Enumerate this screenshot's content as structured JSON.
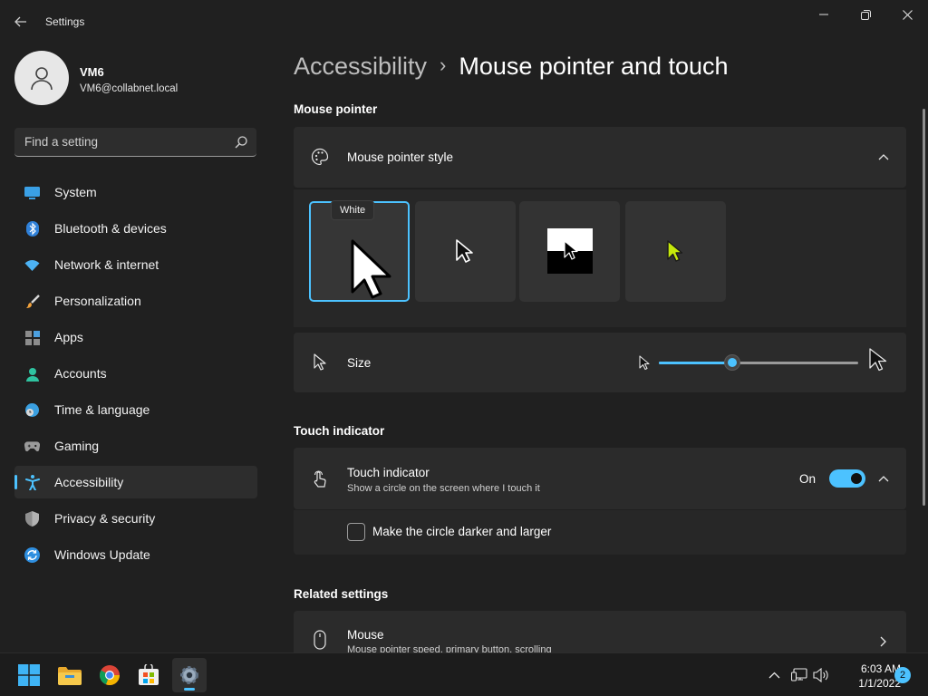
{
  "window": {
    "title": "Settings"
  },
  "user": {
    "name": "VM6",
    "email": "VM6@collabnet.local"
  },
  "search": {
    "placeholder": "Find a setting"
  },
  "sidebar": {
    "items": [
      {
        "label": "System",
        "icon": "monitor-icon"
      },
      {
        "label": "Bluetooth & devices",
        "icon": "bluetooth-icon"
      },
      {
        "label": "Network & internet",
        "icon": "wifi-icon"
      },
      {
        "label": "Personalization",
        "icon": "brush-icon"
      },
      {
        "label": "Apps",
        "icon": "apps-icon"
      },
      {
        "label": "Accounts",
        "icon": "person-icon"
      },
      {
        "label": "Time & language",
        "icon": "globe-clock-icon"
      },
      {
        "label": "Gaming",
        "icon": "gamepad-icon"
      },
      {
        "label": "Accessibility",
        "icon": "accessibility-icon",
        "active": true
      },
      {
        "label": "Privacy & security",
        "icon": "shield-icon"
      },
      {
        "label": "Windows Update",
        "icon": "sync-icon"
      }
    ]
  },
  "breadcrumb": {
    "parent": "Accessibility",
    "separator": "›",
    "current": "Mouse pointer and touch"
  },
  "mouse_pointer": {
    "section_title": "Mouse pointer",
    "style_label": "Mouse pointer style",
    "styles": [
      {
        "tooltip": "White",
        "selected": true
      },
      {
        "selected": false
      },
      {
        "selected": false
      },
      {
        "selected": false
      }
    ],
    "size_label": "Size",
    "size_value_fraction": 0.37
  },
  "touch": {
    "section_title": "Touch indicator",
    "label": "Touch indicator",
    "description": "Show a circle on the screen where I touch it",
    "state": "On",
    "checkbox_label": "Make the circle darker and larger"
  },
  "related": {
    "section_title": "Related settings",
    "mouse_label": "Mouse",
    "mouse_description": "Mouse pointer speed, primary button, scrolling"
  },
  "taskbar": {
    "time": "6:03 AM",
    "date": "1/1/2022",
    "notifications": "2"
  },
  "colors": {
    "accent": "#4cc2ff",
    "background": "#202020",
    "card": "#2b2b2b",
    "lime_pointer": "#c5e80b"
  }
}
